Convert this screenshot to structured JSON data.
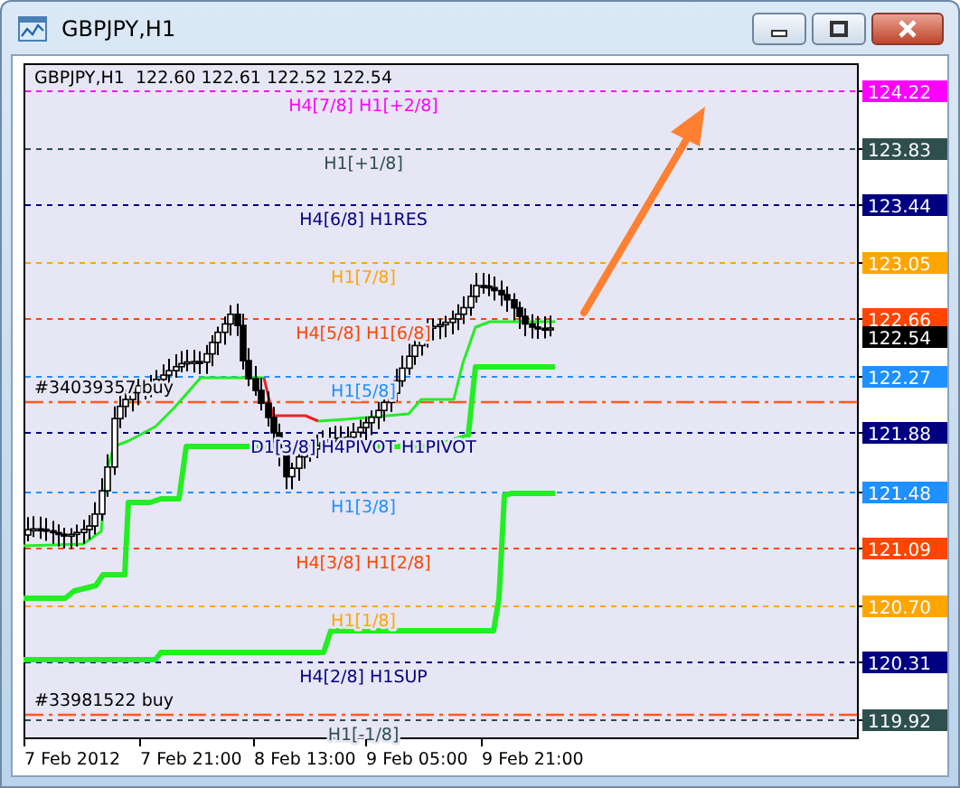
{
  "window": {
    "title": "GBPJPY,H1"
  },
  "chart": {
    "header": "GBPJPY,H1  122.60 122.61 122.52 122.54",
    "levels": [
      {
        "price": "124.22",
        "label": "H4[7/8] H1[+2/8]",
        "color": "#ff00ff"
      },
      {
        "price": "123.83",
        "label": "H1[+1/8]",
        "color": "#2f4f4f"
      },
      {
        "price": "123.44",
        "label": "H4[6/8] H1RES",
        "color": "#000080"
      },
      {
        "price": "123.05",
        "label": "H1[7/8]",
        "color": "#ffa500"
      },
      {
        "price": "122.66",
        "label": "H4[5/8] H1[6/8]",
        "color": "#ff4500"
      },
      {
        "price": "122.27",
        "label": "H1[5/8]",
        "color": "#1e90ff"
      },
      {
        "price": "121.88",
        "label": "D1[3/8] H4PIVOT H1PIVOT",
        "color": "#000080"
      },
      {
        "price": "121.48",
        "label": "H1[3/8]",
        "color": "#1e90ff"
      },
      {
        "price": "121.09",
        "label": "H4[3/8] H1[2/8]",
        "color": "#ff4500"
      },
      {
        "price": "120.70",
        "label": "H1[1/8]",
        "color": "#ffa500"
      },
      {
        "price": "120.31",
        "label": "H4[2/8] H1SUP",
        "color": "#000080"
      },
      {
        "price": "119.92",
        "label": "H1[-1/8]",
        "color": "#2f4f4f"
      }
    ],
    "current_price": "122.54",
    "orders": [
      {
        "label": "#34039357 buy"
      },
      {
        "label": "#33981522 buy"
      }
    ],
    "time_labels": [
      "7 Feb 2012",
      "7 Feb 21:00",
      "8 Feb 13:00",
      "9 Feb 05:00",
      "9 Feb 21:00"
    ]
  }
}
